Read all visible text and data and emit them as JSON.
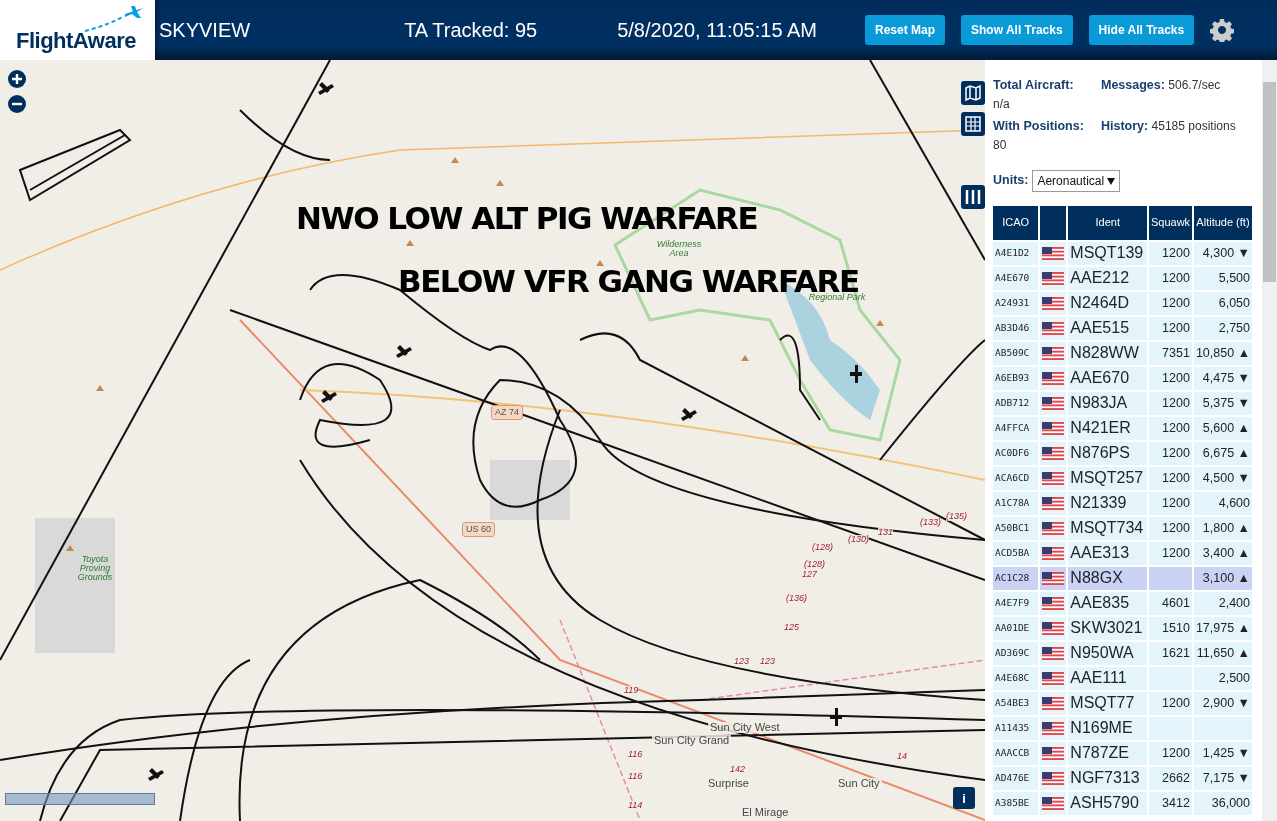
{
  "header": {
    "logo": "FlightAware",
    "title": "SKYVIEW",
    "tracked": "TA Tracked: 95",
    "datetime": "5/8/2020, 11:05:15 AM",
    "buttons": [
      "Reset Map",
      "Show All Tracks",
      "Hide All Tracks"
    ]
  },
  "map": {
    "labels": [
      {
        "kind": "shield",
        "text": "AZ 74"
      },
      {
        "kind": "shield",
        "text": "US 60"
      },
      {
        "kind": "park",
        "text": "Toyota Proving Grounds"
      },
      {
        "kind": "park",
        "text": "Wilderness Area"
      },
      {
        "kind": "park",
        "text": "Regional Park"
      },
      {
        "kind": "place",
        "text": "Sun City Grand"
      },
      {
        "kind": "place",
        "text": "Sun City West"
      },
      {
        "kind": "place",
        "text": "Surprise"
      },
      {
        "kind": "place",
        "text": "Sun City"
      },
      {
        "kind": "place",
        "text": "El Mirage"
      },
      {
        "kind": "route",
        "text": "(133)"
      },
      {
        "kind": "route",
        "text": "(135)"
      },
      {
        "kind": "route",
        "text": "(130)"
      },
      {
        "kind": "route",
        "text": "131"
      },
      {
        "kind": "route",
        "text": "(128)"
      },
      {
        "kind": "route",
        "text": "(128)"
      },
      {
        "kind": "route",
        "text": "127"
      },
      {
        "kind": "route",
        "text": "(136)"
      },
      {
        "kind": "route",
        "text": "125"
      },
      {
        "kind": "route",
        "text": "123"
      },
      {
        "kind": "route",
        "text": "123"
      },
      {
        "kind": "route",
        "text": "119"
      },
      {
        "kind": "route",
        "text": "116"
      },
      {
        "kind": "route",
        "text": "116"
      },
      {
        "kind": "route",
        "text": "114"
      },
      {
        "kind": "route",
        "text": "142"
      },
      {
        "kind": "route",
        "text": "14"
      }
    ],
    "annotations": [
      "NWO LOW ALT PIG WARFARE",
      "BELOW VFR GANG WARFARE"
    ],
    "info_button": "i"
  },
  "sidebar": {
    "stats": [
      {
        "label": "Total Aircraft:",
        "value": "n/a"
      },
      {
        "label": "Messages:",
        "value": "506.7/sec"
      },
      {
        "label": "With Positions:",
        "value": "80"
      },
      {
        "label": "History:",
        "value": "45185 positions"
      }
    ],
    "units": {
      "label": "Units:",
      "value": "Aeronautical"
    },
    "table": {
      "columns": [
        "ICAO",
        "",
        "Ident",
        "Squawk",
        "Altitude (ft)"
      ],
      "rows": [
        {
          "icao": "A4E1D2",
          "ident": "MSQT139",
          "squawk": "1200",
          "altitude": "4,300 ▼",
          "selected": false
        },
        {
          "icao": "A4E670",
          "ident": "AAE212",
          "squawk": "1200",
          "altitude": "5,500",
          "selected": false
        },
        {
          "icao": "A24931",
          "ident": "N2464D",
          "squawk": "1200",
          "altitude": "6,050",
          "selected": false
        },
        {
          "icao": "AB3D46",
          "ident": "AAE515",
          "squawk": "1200",
          "altitude": "2,750",
          "selected": false
        },
        {
          "icao": "AB509C",
          "ident": "N828WW",
          "squawk": "7351",
          "altitude": "10,850 ▲",
          "selected": false
        },
        {
          "icao": "A6EB93",
          "ident": "AAE670",
          "squawk": "1200",
          "altitude": "4,475 ▼",
          "selected": false
        },
        {
          "icao": "ADB712",
          "ident": "N983JA",
          "squawk": "1200",
          "altitude": "5,375 ▼",
          "selected": false
        },
        {
          "icao": "A4FFCA",
          "ident": "N421ER",
          "squawk": "1200",
          "altitude": "5,600 ▲",
          "selected": false
        },
        {
          "icao": "AC0DF6",
          "ident": "N876PS",
          "squawk": "1200",
          "altitude": "6,675 ▲",
          "selected": false
        },
        {
          "icao": "ACA6CD",
          "ident": "MSQT257",
          "squawk": "1200",
          "altitude": "4,500 ▼",
          "selected": false
        },
        {
          "icao": "A1C78A",
          "ident": "N21339",
          "squawk": "1200",
          "altitude": "4,600",
          "selected": false
        },
        {
          "icao": "A50BC1",
          "ident": "MSQT734",
          "squawk": "1200",
          "altitude": "1,800 ▲",
          "selected": false
        },
        {
          "icao": "ACD5BA",
          "ident": "AAE313",
          "squawk": "1200",
          "altitude": "3,400 ▲",
          "selected": false
        },
        {
          "icao": "AC1C28",
          "ident": "N88GX",
          "squawk": "",
          "altitude": "3,100 ▲",
          "selected": true
        },
        {
          "icao": "A4E7F9",
          "ident": "AAE835",
          "squawk": "4601",
          "altitude": "2,400",
          "selected": false
        },
        {
          "icao": "AA01DE",
          "ident": "SKW3021",
          "squawk": "1510",
          "altitude": "17,975 ▲",
          "selected": false
        },
        {
          "icao": "AD369C",
          "ident": "N950WA",
          "squawk": "1621",
          "altitude": "11,650 ▲",
          "selected": false
        },
        {
          "icao": "A4E68C",
          "ident": "AAE111",
          "squawk": "",
          "altitude": "2,500",
          "selected": false
        },
        {
          "icao": "A54BE3",
          "ident": "MSQT77",
          "squawk": "1200",
          "altitude": "2,900 ▼",
          "selected": false
        },
        {
          "icao": "A11435",
          "ident": "N169ME",
          "squawk": "",
          "altitude": "",
          "selected": false
        },
        {
          "icao": "AAACCB",
          "ident": "N787ZE",
          "squawk": "1200",
          "altitude": "1,425 ▼",
          "selected": false
        },
        {
          "icao": "AD476E",
          "ident": "NGF7313",
          "squawk": "2662",
          "altitude": "7,175 ▼",
          "selected": false
        },
        {
          "icao": "A385BE",
          "ident": "ASH5790",
          "squawk": "3412",
          "altitude": "36,000",
          "selected": false
        }
      ]
    }
  }
}
